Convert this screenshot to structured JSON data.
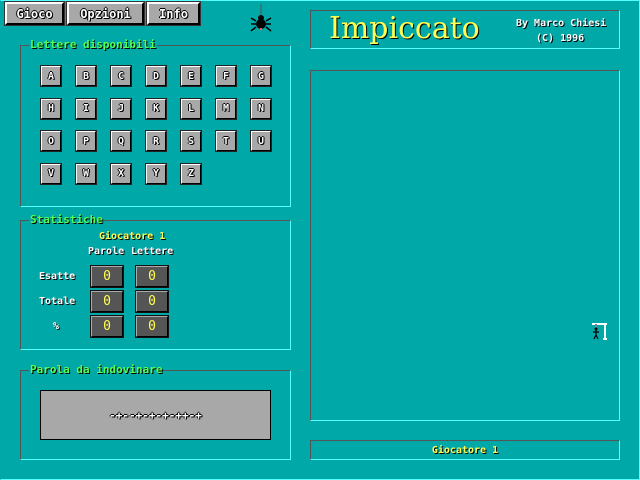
{
  "menu": {
    "gioco": "Gioco",
    "opzioni": "Opzioni",
    "info": "Info"
  },
  "title": {
    "name": "Impiccato",
    "author": "By Marco Chiesi",
    "copyright": "(C) 1996"
  },
  "letters_panel": {
    "title": "Lettere disponibili",
    "letters": [
      "A",
      "B",
      "C",
      "D",
      "E",
      "F",
      "G",
      "H",
      "I",
      "J",
      "K",
      "L",
      "M",
      "N",
      "O",
      "P",
      "Q",
      "R",
      "S",
      "T",
      "U",
      "V",
      "W",
      "X",
      "Y",
      "Z"
    ]
  },
  "stats": {
    "title": "Statistiche",
    "player": "Giocatore 1",
    "col_words": "Parole",
    "col_letters": "Lettere",
    "rows": [
      {
        "label": "Esatte",
        "words": "0",
        "letters": "0"
      },
      {
        "label": "Totale",
        "words": "0",
        "letters": "0"
      },
      {
        "label": "%",
        "words": "0",
        "letters": "0"
      }
    ]
  },
  "word_panel": {
    "title": "Parola da indovinare",
    "word": "-+--+-+-+-++-+"
  },
  "status": {
    "player": "Giocatore 1"
  }
}
